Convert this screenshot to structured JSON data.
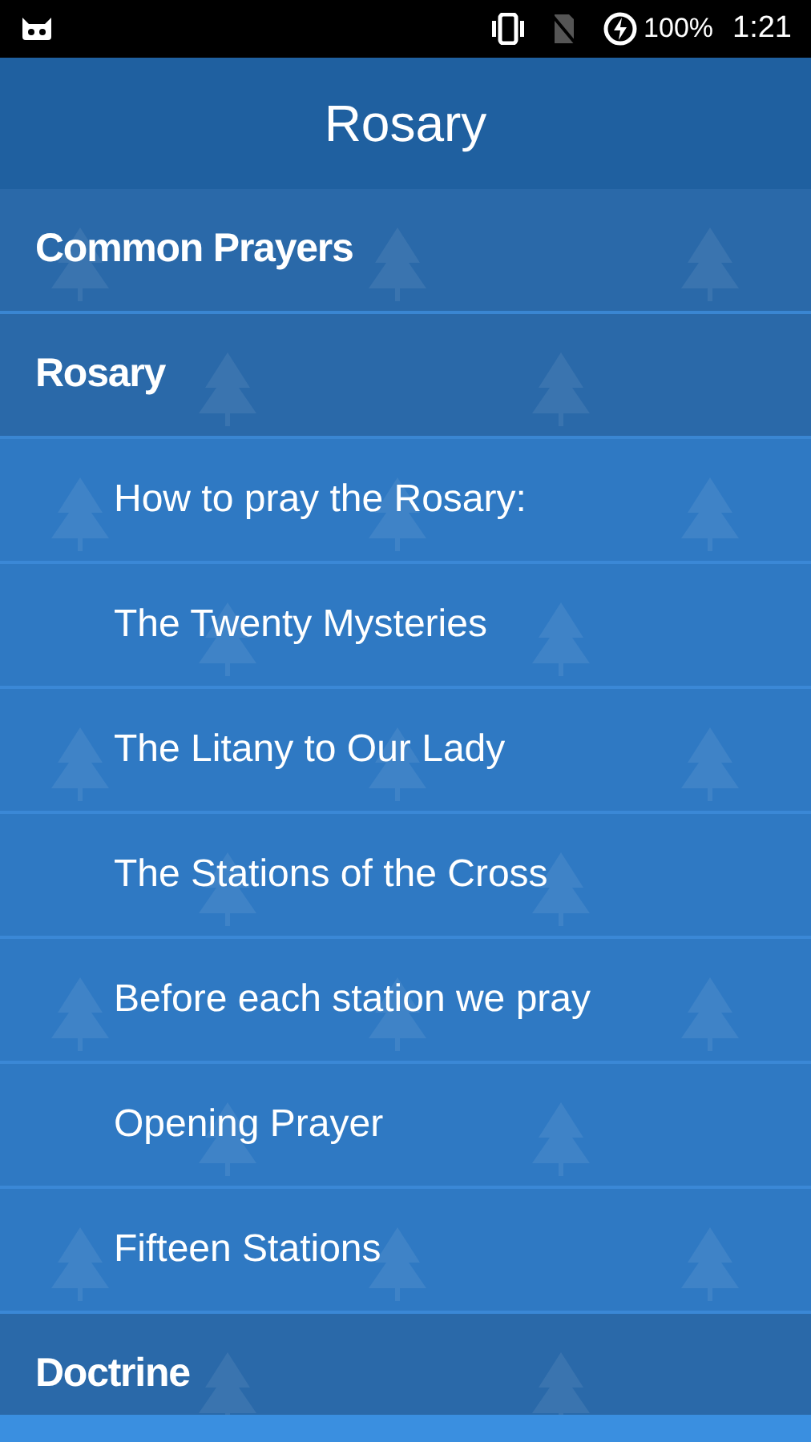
{
  "status_bar": {
    "battery": "100%",
    "time": "1:21"
  },
  "header": {
    "title": "Rosary"
  },
  "sections": [
    {
      "title": "Common Prayers"
    },
    {
      "title": "Rosary",
      "children": [
        {
          "title": "How to pray the Rosary:"
        },
        {
          "title": "The Twenty Mysteries"
        },
        {
          "title": "The Litany to Our Lady"
        },
        {
          "title": "The Stations of the Cross"
        },
        {
          "title": "Before each station we pray"
        },
        {
          "title": "Opening Prayer"
        },
        {
          "title": "Fifteen Stations"
        }
      ]
    },
    {
      "title": "Doctrine"
    }
  ]
}
